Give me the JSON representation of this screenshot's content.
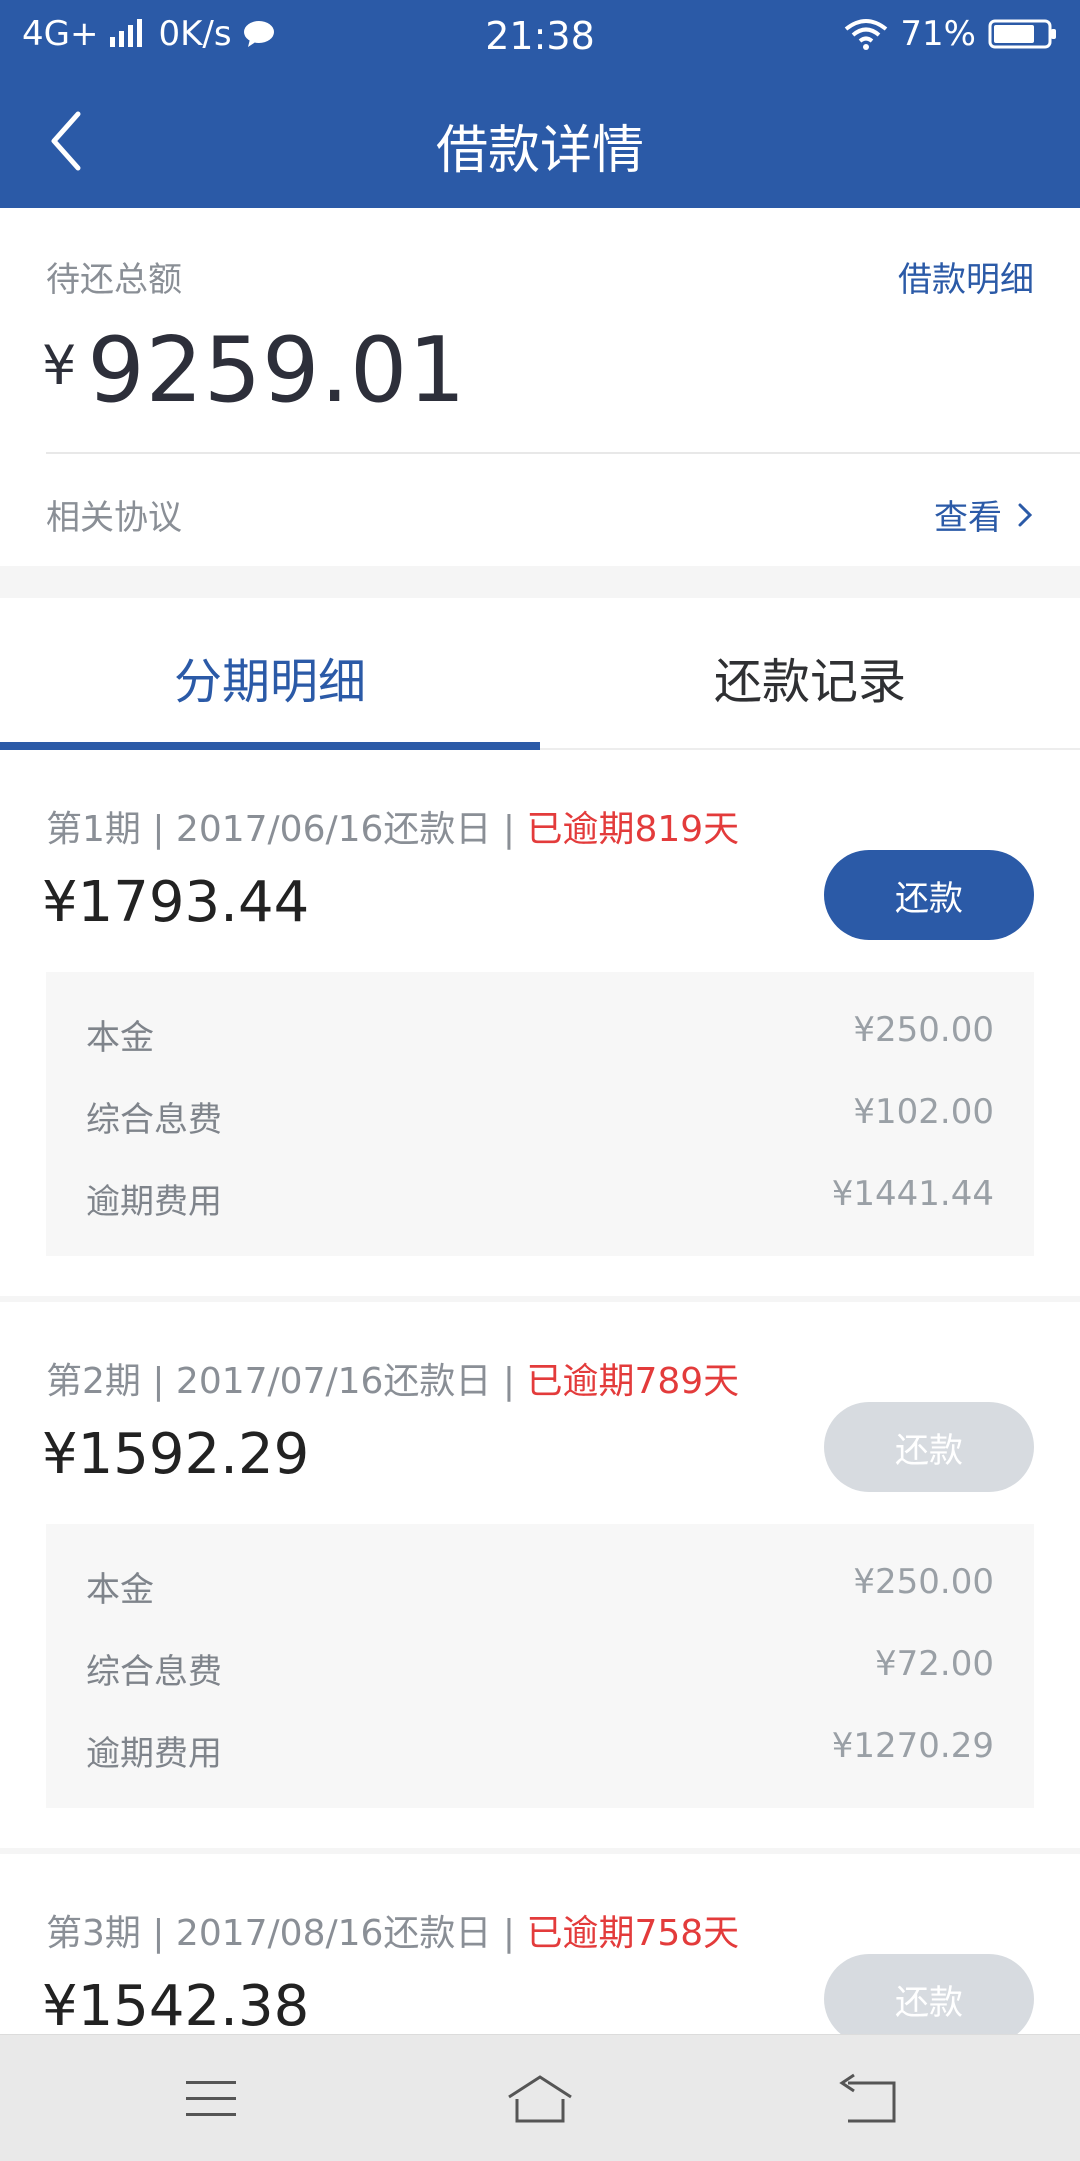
{
  "status_bar": {
    "network": "4G+",
    "speed": "0K/s",
    "time": "21:38",
    "battery": "71%"
  },
  "header": {
    "title": "借款详情"
  },
  "summary": {
    "total_label": "待还总额",
    "details_link": "借款明细",
    "currency": "¥",
    "total_amount": "9259.01",
    "agreement_label": "相关协议",
    "view_label": "查看"
  },
  "tabs": [
    {
      "label": "分期明细",
      "active": true
    },
    {
      "label": "还款记录",
      "active": false
    }
  ],
  "installments": [
    {
      "period": "第1期",
      "due_date": "2017/06/16还款日",
      "status": "已逾期819天",
      "amount": "¥1793.44",
      "button": "还款",
      "button_enabled": true,
      "breakdown": [
        {
          "label": "本金",
          "value": "¥250.00"
        },
        {
          "label": "综合息费",
          "value": "¥102.00"
        },
        {
          "label": "逾期费用",
          "value": "¥1441.44"
        }
      ]
    },
    {
      "period": "第2期",
      "due_date": "2017/07/16还款日",
      "status": "已逾期789天",
      "amount": "¥1592.29",
      "button": "还款",
      "button_enabled": false,
      "breakdown": [
        {
          "label": "本金",
          "value": "¥250.00"
        },
        {
          "label": "综合息费",
          "value": "¥72.00"
        },
        {
          "label": "逾期费用",
          "value": "¥1270.29"
        }
      ]
    },
    {
      "period": "第3期",
      "due_date": "2017/08/16还款日",
      "status": "已逾期758天",
      "amount": "¥1542.38",
      "button": "还款",
      "button_enabled": false
    }
  ],
  "bottom_nav": {
    "icons": [
      "menu-icon",
      "home-icon",
      "back-icon"
    ]
  },
  "colors": {
    "primary": "#2b5aa7",
    "overdue": "#e33b3b",
    "disabled": "#d7dbe0"
  }
}
